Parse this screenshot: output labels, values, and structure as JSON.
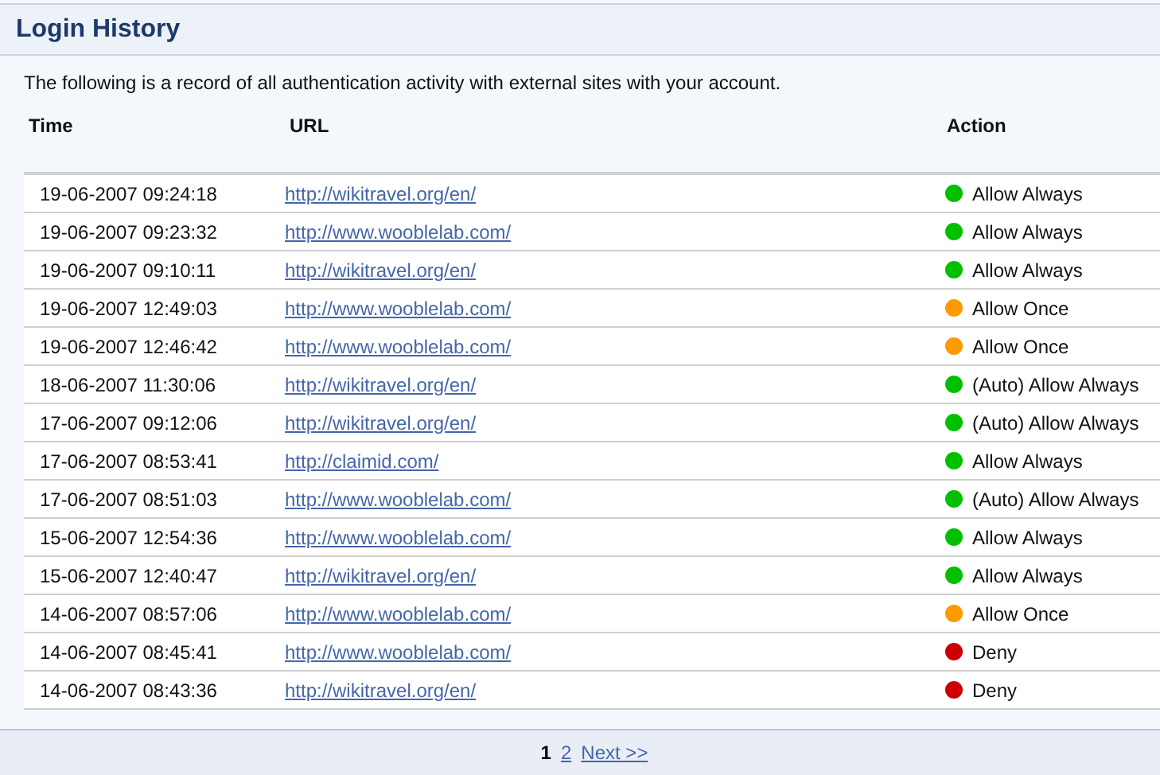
{
  "title": "Login History",
  "intro": "The following is a record of all authentication activity with external sites with your account.",
  "table": {
    "columns": [
      "Time",
      "URL",
      "Action"
    ],
    "rows": [
      {
        "time": "19-06-2007 09:24:18",
        "url": "http://wikitravel.org/en/",
        "action": "Allow Always",
        "color": "#00c000"
      },
      {
        "time": "19-06-2007 09:23:32",
        "url": "http://www.wooblelab.com/",
        "action": "Allow Always",
        "color": "#00c000"
      },
      {
        "time": "19-06-2007 09:10:11",
        "url": "http://wikitravel.org/en/",
        "action": "Allow Always",
        "color": "#00c000"
      },
      {
        "time": "19-06-2007 12:49:03",
        "url": "http://www.wooblelab.com/",
        "action": "Allow Once",
        "color": "#ff9900"
      },
      {
        "time": "19-06-2007 12:46:42",
        "url": "http://www.wooblelab.com/",
        "action": "Allow Once",
        "color": "#ff9900"
      },
      {
        "time": "18-06-2007 11:30:06",
        "url": "http://wikitravel.org/en/",
        "action": "(Auto) Allow Always",
        "color": "#00c000"
      },
      {
        "time": "17-06-2007 09:12:06",
        "url": "http://wikitravel.org/en/",
        "action": "(Auto) Allow Always",
        "color": "#00c000"
      },
      {
        "time": "17-06-2007 08:53:41",
        "url": "http://claimid.com/",
        "action": "Allow Always",
        "color": "#00c000"
      },
      {
        "time": "17-06-2007 08:51:03",
        "url": "http://www.wooblelab.com/",
        "action": "(Auto) Allow Always",
        "color": "#00c000"
      },
      {
        "time": "15-06-2007 12:54:36",
        "url": "http://www.wooblelab.com/",
        "action": "Allow Always",
        "color": "#00c000"
      },
      {
        "time": "15-06-2007 12:40:47",
        "url": "http://wikitravel.org/en/",
        "action": "Allow Always",
        "color": "#00c000"
      },
      {
        "time": "14-06-2007 08:57:06",
        "url": "http://www.wooblelab.com/",
        "action": "Allow Once",
        "color": "#ff9900"
      },
      {
        "time": "14-06-2007 08:45:41",
        "url": "http://www.wooblelab.com/",
        "action": "Deny",
        "color": "#cc0000"
      },
      {
        "time": "14-06-2007 08:43:36",
        "url": "http://wikitravel.org/en/",
        "action": "Deny",
        "color": "#cc0000"
      }
    ]
  },
  "pagination": {
    "pages": [
      {
        "label": "1",
        "selected": true
      },
      {
        "label": "2",
        "selected": false
      }
    ],
    "next": "Next >>"
  }
}
